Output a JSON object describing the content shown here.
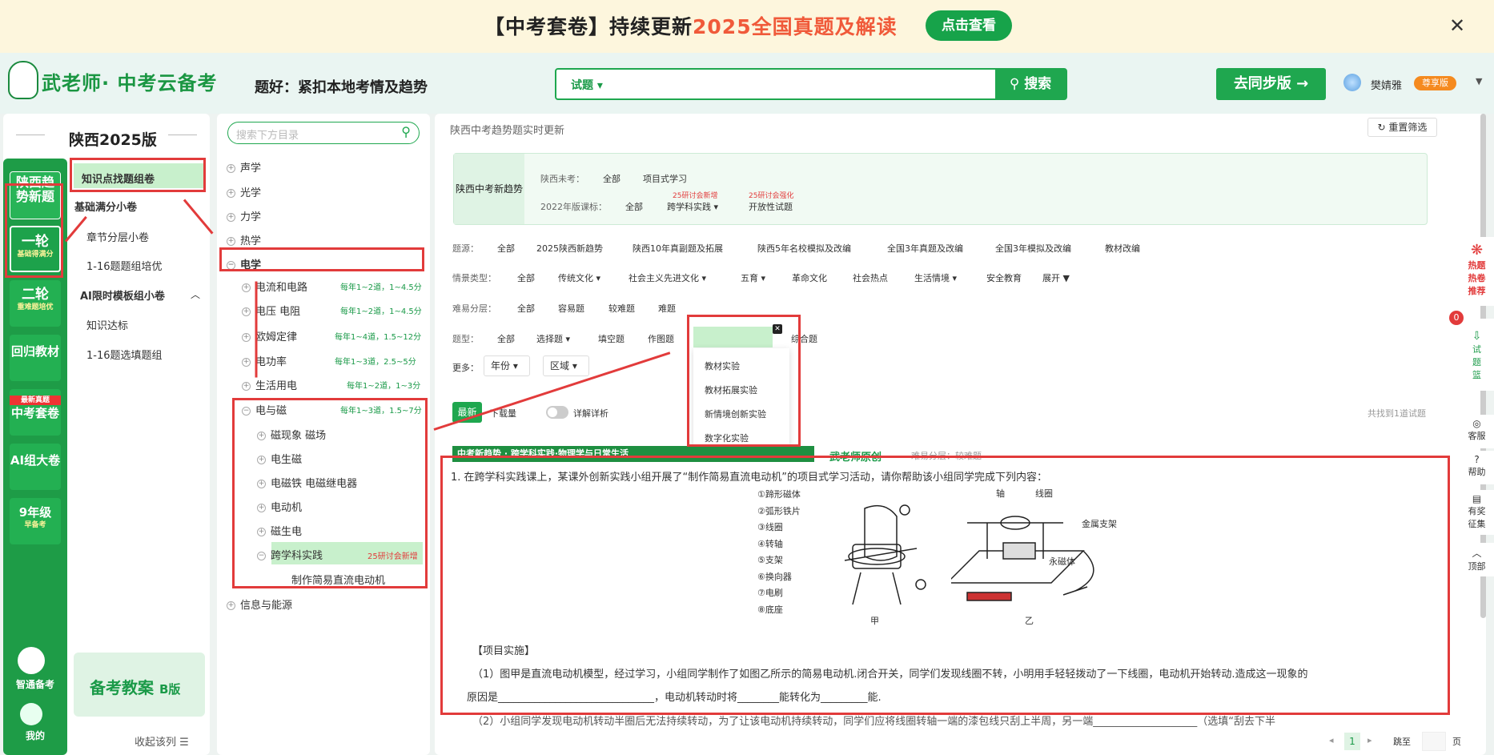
{
  "banner": {
    "prefix": "【中考套卷】持续更新",
    "highlight": "2025全国真题及解读",
    "button": "点击查看"
  },
  "header": {
    "brand": "武老师",
    "brand_sub": "· 中考云备考",
    "slogan": "题好：紧扣本地考情及趋势",
    "search_type": "试题",
    "search_btn": "搜索",
    "sync_btn": "去同步版 →",
    "user": "樊婧雅",
    "vip": "尊享版"
  },
  "rail": {
    "items": [
      "陕西趋势新题",
      "一轮",
      "二轮",
      "回归教材",
      "中考套卷",
      "AI组大卷",
      "9年级"
    ],
    "sub1": "基础得满分",
    "sub2": "重难题培优",
    "badge": "最新真题",
    "sub9": "早备考",
    "bottom1": "智通备考",
    "bottom2": "我的"
  },
  "region": {
    "title": "陕西2025版",
    "menu": [
      "知识点找题组卷",
      "基础满分小卷",
      "章节分层小卷",
      "1-16题题组培优",
      "AI限时模板组小卷",
      "知识达标",
      "1-16题选填题组"
    ],
    "promo": "备考教案",
    "promo_b": "B版",
    "collapse": "收起该列"
  },
  "tree": {
    "search_ph": "搜索下方目录",
    "top": [
      "声学",
      "光学",
      "力学",
      "热学",
      "电学"
    ],
    "elec": [
      {
        "n": "电流和电路",
        "f": "每年1~2道，1~4.5分"
      },
      {
        "n": "电压 电阻",
        "f": "每年1~2道，1~4.5分"
      },
      {
        "n": "欧姆定律",
        "f": "每年1~4道，1.5~12分"
      },
      {
        "n": "电功率",
        "f": "每年1~3道，2.5~5分"
      },
      {
        "n": "生活用电",
        "f": "每年1~2道，1~3分"
      },
      {
        "n": "电与磁",
        "f": "每年1~3道，1.5~7分"
      }
    ],
    "mag": [
      "磁现象 磁场",
      "电生磁",
      "电磁铁 电磁继电器",
      "电动机",
      "磁生电",
      "跨学科实践"
    ],
    "mag_tag": "25研讨会新增",
    "leaf": "制作简易直流电动机",
    "last": "信息与能源"
  },
  "main": {
    "crumb": "陕西中考趋势题实时更新",
    "reset": "重置筛选",
    "trend_label": "陕西中考新趋势",
    "row1_l": "陕西未考：",
    "row1": [
      "全部",
      "项目式学习"
    ],
    "row2_l": "2022年版课标：",
    "row2": [
      "全部",
      "跨学科实践",
      "开放性试题"
    ],
    "tag_a": "25研讨会新增",
    "tag_b": "25研讨会强化",
    "src_l": "题源：",
    "src": [
      "全部",
      "2025陕西新趋势",
      "陕西10年真副题及拓展",
      "陕西5年名校模拟及改编",
      "全国3年真题及改编",
      "全国3年模拟及改编",
      "教材改编"
    ],
    "sc_l": "情景类型：",
    "sc": [
      "全部",
      "传统文化",
      "社会主义先进文化",
      "五育",
      "革命文化",
      "社会热点",
      "生活情境",
      "安全教育",
      "展开"
    ],
    "df_l": "难易分层：",
    "df": [
      "全部",
      "容易题",
      "较难题",
      "难题"
    ],
    "tp_l": "题型：",
    "tp": [
      "全部",
      "选择题",
      "填空题",
      "作图题",
      "实验与探究题",
      "综合题"
    ],
    "more_l": "更多：",
    "more": [
      "年份",
      "区域"
    ],
    "dd": [
      "教材实验",
      "教材拓展实验",
      "新情境创新实验",
      "数字化实验"
    ],
    "tab1": "最新",
    "tab2": "下载量",
    "toggle": "详解详析",
    "count": "共找到1道试题",
    "qtag": "中考新趋势 · 跨学科实践·物理学与日常生活",
    "orig": "武老师原创",
    "qdiff": "难易分层：较难题",
    "q": "1. 在跨学科实践课上，某课外创新实践小组开展了“制作简易直流电动机”的项目式学习活动，请你帮助该小组同学完成下列内容：",
    "parts": [
      "①蹄形磁体",
      "②弧形铁片",
      "③线圈",
      "④转轴",
      "⑤支架",
      "⑥换向器",
      "⑦电刷",
      "⑧底座"
    ],
    "fig1": "甲",
    "fig2": "乙",
    "lab_axis": "轴",
    "lab_coil": "线圈",
    "lab_frame": "金属支架",
    "lab_mag": "永磁体",
    "impl": "【项目实施】",
    "p1": "（1）图甲是直流电动机模型，经过学习，小组同学制作了如图乙所示的简易电动机.闭合开关，同学们发现线圈不转，小明用手轻轻拨动了一下线圈，电动机开始转动.造成这一现象的",
    "p1b": "原因是______________________________，电动机转动时将________能转化为_________能.",
    "p2": "（2）小组同学发现电动机转动半圈后无法持续转动，为了让该电动机持续转动，同学们应将线圈转轴一端的漆包线只刮上半周，另一端____________________（选填“刮去下半",
    "page": "1",
    "jump": "跳至",
    "page_u": "页"
  },
  "side": [
    "热题热卷推荐",
    "试题篮",
    "客服",
    "帮助",
    "有奖征集",
    "顶部"
  ],
  "basket_count": "0"
}
